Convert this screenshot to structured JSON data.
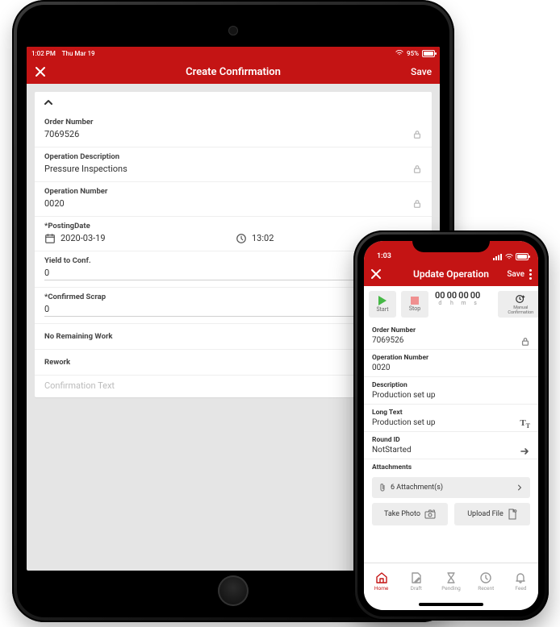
{
  "ipad": {
    "status": {
      "time": "1:02 PM",
      "date": "Thu Mar 19",
      "battery": "95%"
    },
    "header": {
      "title": "Create Confirmation",
      "save": "Save"
    },
    "fields": {
      "order_number": {
        "label": "Order Number",
        "value": "7069526"
      },
      "op_desc": {
        "label": "Operation Description",
        "value": "Pressure Inspections"
      },
      "op_num": {
        "label": "Operation Number",
        "value": "0020"
      },
      "posting": {
        "label": "*PostingDate",
        "date": "2020-03-19",
        "time": "13:02"
      },
      "yield": {
        "label": "Yield to Conf.",
        "value": "0"
      },
      "scrap": {
        "label": "*Confirmed Scrap",
        "value": "0"
      },
      "no_remain": {
        "label": "No Remaining Work"
      },
      "rework": {
        "label": "Rework"
      },
      "conf_text": {
        "placeholder": "Confirmation Text"
      }
    }
  },
  "iphone": {
    "status": {
      "time": "1:03"
    },
    "header": {
      "title": "Update Operation",
      "save": "Save"
    },
    "timer": {
      "start": "Start",
      "stop": "Stop",
      "d": "00",
      "h": "00",
      "m": "00",
      "s": "00",
      "dl": "d",
      "hl": "h",
      "ml": "m",
      "sl": "s",
      "manual": "Manual Confirmation"
    },
    "fields": {
      "order_number": {
        "label": "Order Number",
        "value": "7069526"
      },
      "op_num": {
        "label": "Operation Number",
        "value": "0020"
      },
      "desc": {
        "label": "Description",
        "value": "Production set up"
      },
      "long": {
        "label": "Long Text",
        "value": "Production set up"
      },
      "round": {
        "label": "Round ID",
        "value": "NotStarted"
      },
      "attach": {
        "label": "Attachments",
        "count": "6 Attachment(s)"
      }
    },
    "buttons": {
      "photo": "Take Photo",
      "upload": "Upload File"
    },
    "tabs": {
      "home": "Home",
      "draft": "Draft",
      "pending": "Pending",
      "recent": "Recent",
      "feed": "Feed"
    }
  }
}
